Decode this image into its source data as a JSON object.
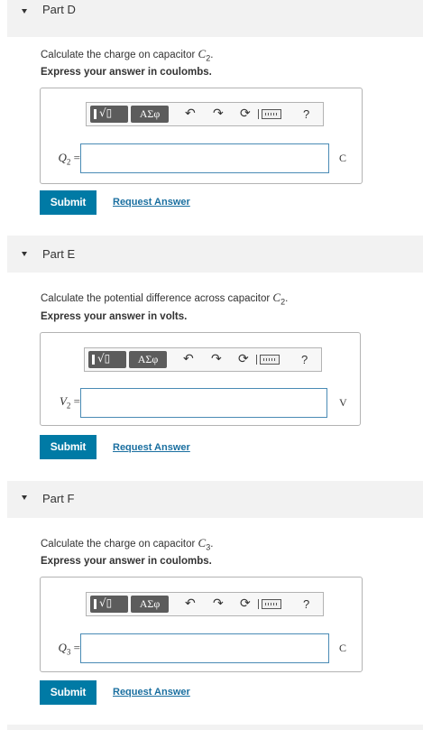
{
  "parts": [
    {
      "title": "Part D",
      "question_prefix": "Calculate the charge on capacitor ",
      "question_var": "C",
      "question_sub": "2",
      "instruction": "Express your answer in coulombs.",
      "var_label": "Q",
      "var_sub": "2",
      "unit": "C",
      "submit_label": "Submit",
      "request_label": "Request Answer"
    },
    {
      "title": "Part E",
      "question_prefix": "Calculate the potential difference across capacitor ",
      "question_var": "C",
      "question_sub": "2",
      "instruction": "Express your answer in volts.",
      "var_label": "V",
      "var_sub": "2",
      "unit": "V",
      "submit_label": "Submit",
      "request_label": "Request Answer"
    },
    {
      "title": "Part F",
      "question_prefix": "Calculate the charge on capacitor ",
      "question_var": "C",
      "question_sub": "3",
      "instruction": "Express your answer in coulombs.",
      "var_label": "Q",
      "var_sub": "3",
      "unit": "C",
      "submit_label": "Submit",
      "request_label": "Request Answer"
    }
  ],
  "toolbar": {
    "template_symbol": "√▯",
    "greek_symbols": "ΑΣφ",
    "undo_icon": "↶",
    "redo_icon": "↷",
    "reset_icon": "⟳",
    "help_symbol": "?"
  },
  "colors": {
    "submit_bg": "#007aa5",
    "link": "#1a6fa0",
    "header_bg": "#f2f2f2",
    "input_border": "#4a8bb5"
  }
}
